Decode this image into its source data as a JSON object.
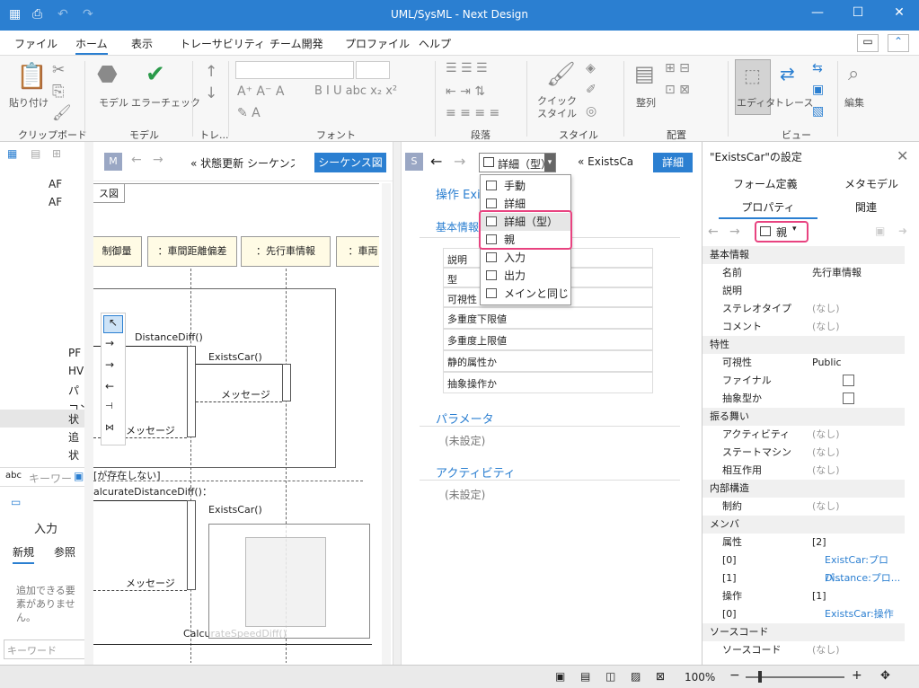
{
  "window": {
    "title": "UML/SysML - Next Design"
  },
  "menu": [
    "ファイル",
    "ホーム",
    "表示",
    "トレーサビリティ",
    "チーム開発",
    "プロファイル",
    "ヘルプ"
  ],
  "ribbon": {
    "paste": "貼り付け",
    "clipboard": "クリップボード",
    "model": "モデル",
    "error_check": "エラーチェック",
    "model_group": "モデル",
    "tre": "トレ...",
    "font_group": "フォント",
    "para_group": "段落",
    "quick_style": "クイック\nスタイル",
    "style_group": "スタイル",
    "align": "整列",
    "layout_group": "配置",
    "editor": "エディタ",
    "trace": "トレース",
    "view_group": "ビュー",
    "edit": "編集"
  },
  "left": {
    "tree": [
      "AF",
      "AF",
      "",
      "",
      "",
      "",
      "",
      "",
      "PF",
      "HV",
      "パ",
      "コン",
      "状",
      "追",
      "状"
    ],
    "search_placeholder": "キーワー",
    "input_title": "入力",
    "tab_new": "新規",
    "tab_ref": "参照",
    "empty_msg": "追加できる要素がありません。",
    "keyword_placeholder": "キーワード"
  },
  "diagram": {
    "badge": "M",
    "breadcrumb": "« 状態更新 シーケンス図",
    "tab_label": "シーケンス図",
    "frame_label": "ス図",
    "lifelines": [
      "制御量",
      "：車間距離偏差",
      "：先行車情報",
      "：車両"
    ],
    "messages": {
      "m1": "DistanceDiff()",
      "m2": "ExistsCar()",
      "m3": "メッセージ",
      "m4": "メッセージ",
      "guard": "[が存在しない]",
      "m5": "alcurateDistanceDiff()：",
      "m6": "ExistsCar()",
      "m7": "メッセージ",
      "m8": "CalcurateSpeedDiff()"
    }
  },
  "mid": {
    "badge": "S",
    "view_select": "詳細（型）",
    "breadcrumb": "« ExistsCa",
    "detail_btn": "詳細",
    "op_title": "操作 Exi",
    "basic_title": "基本情報",
    "rows": [
      "説明",
      "型",
      "可視性",
      "多重度下限値",
      "多重度上限値",
      "静的属性か",
      "抽象操作か"
    ],
    "param_title": "パラメータ",
    "param_value": "(未設定)",
    "activity_title": "アクティビティ",
    "activity_value": "(未設定)"
  },
  "dropdown": {
    "items": [
      "手動",
      "詳細",
      "詳細（型）",
      "親",
      "入力",
      "出力",
      "メインと同じ"
    ]
  },
  "right": {
    "title": "\"ExistsCar\"の設定",
    "tabs": [
      "フォーム定義",
      "メタモデル",
      "プロパティ",
      "関連"
    ],
    "parent_btn": "親",
    "cat_basic": "基本情報",
    "name_k": "名前",
    "name_v": "先行車情報",
    "desc_k": "説明",
    "stereo_k": "ステレオタイプ",
    "stereo_v": "(なし)",
    "comment_k": "コメント",
    "comment_v": "(なし)",
    "cat_attr": "特性",
    "vis_k": "可視性",
    "vis_v": "Public",
    "final_k": "ファイナル",
    "abstract_k": "抽象型か",
    "cat_behav": "振る舞い",
    "activity_k": "アクティビティ",
    "activity_v": "(なし)",
    "state_k": "ステートマシン",
    "state_v": "(なし)",
    "interact_k": "相互作用",
    "interact_v": "(なし)",
    "cat_internal": "内部構造",
    "constraint_k": "制約",
    "constraint_v": "(なし)",
    "cat_member": "メンバ",
    "attr_k": "属性",
    "attr_v": "[2]",
    "attr0_k": "[0]",
    "attr0_v": "ExistCar:プロパ...",
    "attr1_k": "[1]",
    "attr1_v": "Distance:プロ...",
    "op_k": "操作",
    "op_v": "[1]",
    "op0_k": "[0]",
    "op0_v": "ExistsCar:操作",
    "cat_src": "ソースコード",
    "src_k": "ソースコード",
    "src_v": "(なし)"
  },
  "status": {
    "zoom": "100%"
  }
}
